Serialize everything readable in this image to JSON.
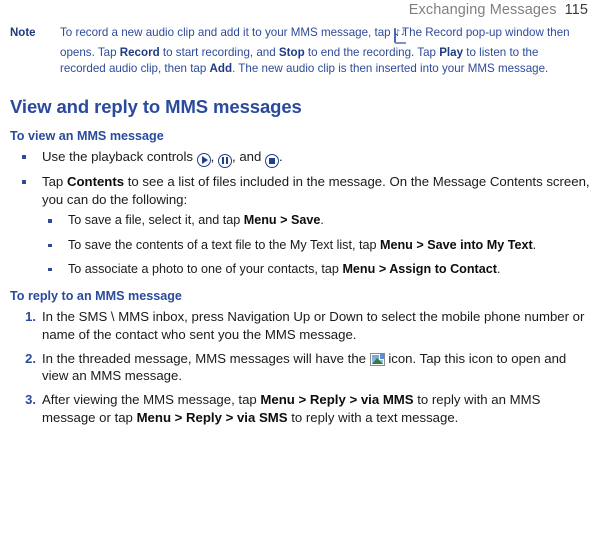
{
  "header": {
    "title": "Exchanging Messages",
    "page_number": "115"
  },
  "note": {
    "label": "Note",
    "text_part_1": "To record a new audio clip and add it to your MMS message, tap ",
    "icon_name": "record-audio-icon",
    "text_part_2": ". The Record pop-up window then opens. Tap ",
    "bold_1": "Record",
    "text_part_3": " to start recording, and ",
    "bold_2": "Stop",
    "text_part_4": " to end the recording. Tap ",
    "bold_3": "Play",
    "text_part_5": " to listen to the recorded audio clip, then tap ",
    "bold_4": "Add",
    "text_part_6": ". The new audio clip is then inserted into your MMS message."
  },
  "section": {
    "title": "View and reply to MMS messages"
  },
  "view_section": {
    "subtitle": "To view an MMS message",
    "bullet_1": {
      "text_part_1": "Use the playback controls ",
      "icon_play": "play-icon",
      "sep_1": ", ",
      "icon_pause": "pause-icon",
      "sep_2": ", and ",
      "icon_stop": "stop-icon",
      "text_part_2": "."
    },
    "bullet_2": {
      "text_part_1": "Tap ",
      "bold_1": "Contents",
      "text_part_2": " to see a list of files included in the message. On the Message Contents screen, you can do the following:",
      "sub_bullets": [
        {
          "text_part_1": "To save a file, select it, and tap ",
          "bold_1": "Menu > Save",
          "text_part_2": "."
        },
        {
          "text_part_1": "To save the contents of a text file to the My Text list, tap ",
          "bold_1": "Menu > Save into My Text",
          "text_part_2": "."
        },
        {
          "text_part_1": "To associate a photo to one of your contacts, tap ",
          "bold_1": "Menu > Assign to Contact",
          "text_part_2": "."
        }
      ]
    }
  },
  "reply_section": {
    "subtitle": "To reply to an MMS message",
    "steps": [
      {
        "number": "1.",
        "text_part_1": "In the SMS \\ MMS inbox, press Navigation Up or Down to select the mobile phone number or name of the contact who sent you the MMS message.",
        "icon_name": "",
        "text_part_2": ""
      },
      {
        "number": "2.",
        "text_part_1": "In the threaded message, MMS messages will have the ",
        "icon_name": "mms-picture-icon",
        "text_part_2": " icon. Tap this icon to open and view an MMS message."
      },
      {
        "number": "3.",
        "text_part_1": "After viewing the MMS message, tap ",
        "bold_1": "Menu > Reply > via MMS",
        "text_part_2": " to reply with an MMS message or tap ",
        "bold_2": "Menu > Reply > via SMS",
        "text_part_3": " to reply with a text message."
      }
    ]
  },
  "colors": {
    "heading_blue": "#2a4a9e",
    "note_blue": "#2e4b9b",
    "body_black": "#1a1a1a",
    "header_gray": "#808080"
  }
}
